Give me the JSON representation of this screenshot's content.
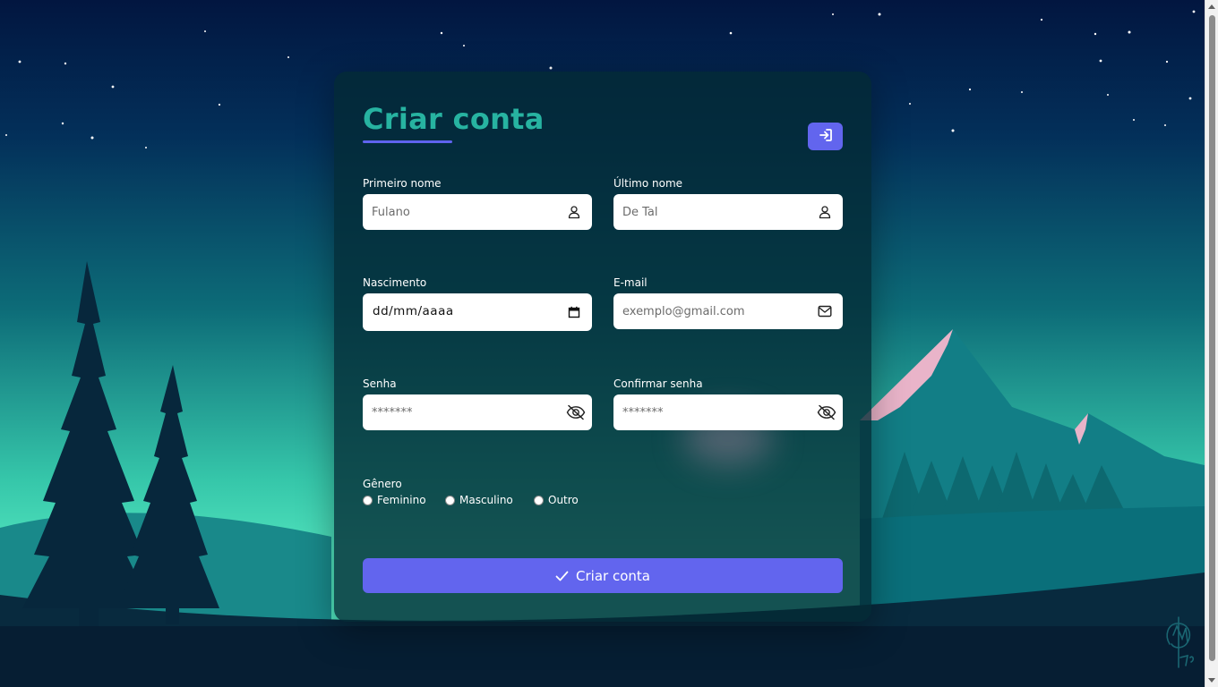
{
  "form": {
    "title": "Criar conta",
    "login_icon": "sign-in-icon",
    "fields": {
      "first_name": {
        "label": "Primeiro nome",
        "placeholder": "Fulano",
        "icon": "user-icon"
      },
      "last_name": {
        "label": "Último nome",
        "placeholder": "De Tal",
        "icon": "user-icon"
      },
      "birth": {
        "label": "Nascimento",
        "value": "dd/mm/aaaa",
        "icon": "calendar-icon"
      },
      "email": {
        "label": "E-mail",
        "placeholder": "exemplo@gmail.com",
        "icon": "mail-icon"
      },
      "password": {
        "label": "Senha",
        "placeholder": "*******",
        "icon": "eye-off-icon"
      },
      "confirm_password": {
        "label": "Confirmar senha",
        "placeholder": "*******",
        "icon": "eye-off-icon"
      }
    },
    "gender": {
      "label": "Gênero",
      "options": [
        "Feminino",
        "Masculino",
        "Outro"
      ]
    },
    "submit_label": "Criar conta",
    "submit_icon": "check-icon"
  },
  "colors": {
    "accent": "#6265ee",
    "title": "#27b3a1",
    "card": "#042a34",
    "sky": "#021640",
    "mountain_snow": "#e9b4c9"
  }
}
